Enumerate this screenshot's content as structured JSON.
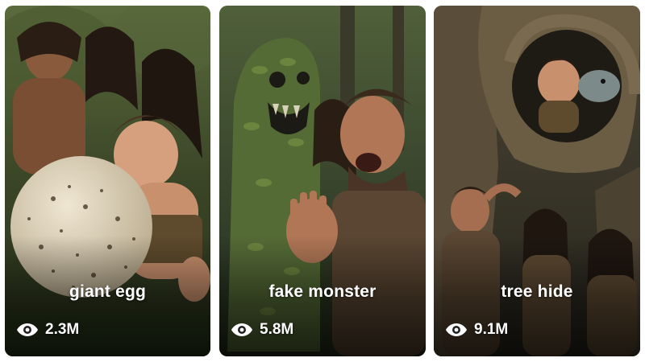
{
  "cards": [
    {
      "caption": "giant egg",
      "views": "2.3M",
      "icon": "eye-icon",
      "colors": {
        "sky": "#3d4a2c",
        "ground": "#2f3a1e",
        "accent": "#d9cdb4"
      }
    },
    {
      "caption": "fake monster",
      "views": "5.8M",
      "icon": "eye-icon",
      "colors": {
        "sky": "#37432a",
        "ground": "#2a3320",
        "accent": "#8a9a4c"
      }
    },
    {
      "caption": "tree hide",
      "views": "9.1M",
      "icon": "eye-icon",
      "colors": {
        "sky": "#3f3a2e",
        "ground": "#2c2a22",
        "accent": "#7a6a50"
      }
    }
  ]
}
